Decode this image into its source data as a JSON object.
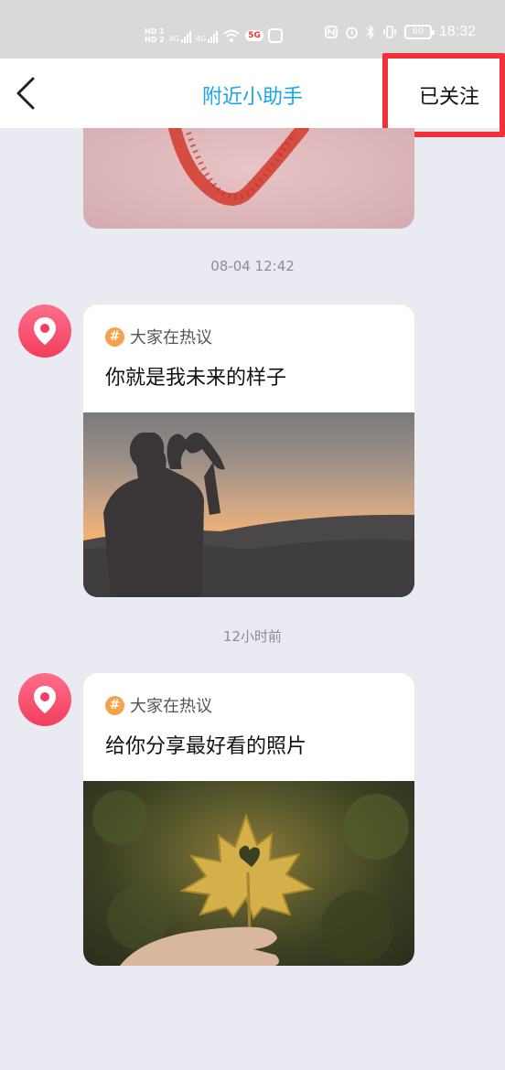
{
  "status_bar": {
    "hd_top": "HD 1",
    "hd_bottom": "HD 2",
    "net1": "4G",
    "net2": "4G",
    "badge_5g": "5G",
    "battery": "60",
    "time": "18:32"
  },
  "nav": {
    "title": "附近小助手",
    "follow_label": "已关注"
  },
  "feed": {
    "messages": [
      {
        "timestamp": "08-04 12:42",
        "topic": "大家在热议",
        "title": "你就是我未来的样子"
      },
      {
        "timestamp": "12小时前",
        "topic": "大家在热议",
        "title": "给你分享最好看的照片"
      }
    ]
  },
  "colors": {
    "accent": "#1aa6ee",
    "highlight": "#f1303a",
    "avatar": "#f23e5f",
    "hash_badge": "#f7a24b",
    "background": "#eaebf2"
  },
  "icons": {
    "back": "chevron-left-icon",
    "avatar": "location-pin-icon",
    "topic": "hash-icon"
  }
}
